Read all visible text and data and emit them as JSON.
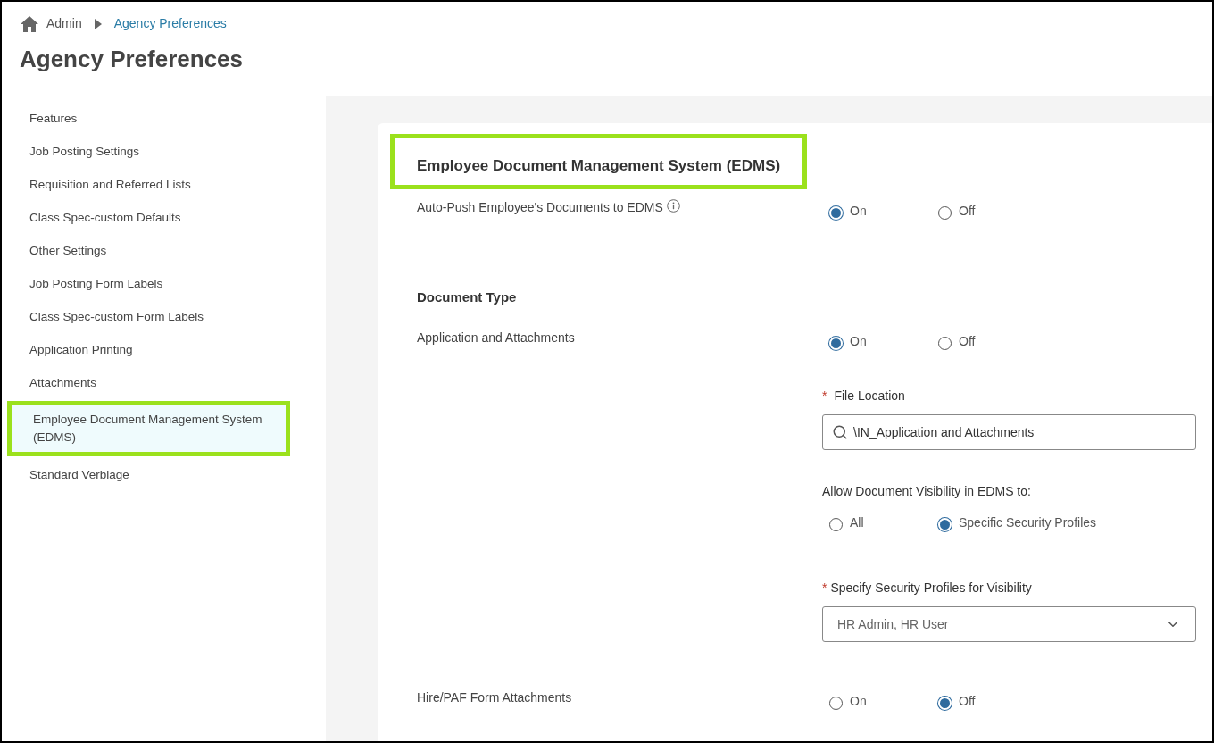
{
  "breadcrumb": [
    {
      "label": "Admin",
      "link": false
    },
    {
      "label": "Agency Preferences",
      "link": true
    }
  ],
  "title": "Agency Preferences",
  "sidebar": {
    "items": [
      {
        "label": "Features",
        "selected": false,
        "highlighted": false
      },
      {
        "label": "Job Posting Settings",
        "selected": false,
        "highlighted": false
      },
      {
        "label": "Requisition and Referred Lists",
        "selected": false,
        "highlighted": false
      },
      {
        "label": "Class Spec-custom Defaults",
        "selected": false,
        "highlighted": false
      },
      {
        "label": "Other Settings",
        "selected": false,
        "highlighted": false
      },
      {
        "label": "Job Posting Form Labels",
        "selected": false,
        "highlighted": false
      },
      {
        "label": "Class Spec-custom Form Labels",
        "selected": false,
        "highlighted": false
      },
      {
        "label": "Application Printing",
        "selected": false,
        "highlighted": false
      },
      {
        "label": "Attachments",
        "selected": false,
        "highlighted": false
      },
      {
        "label": "Employee Document Management System (EDMS)",
        "selected": true,
        "highlighted": true
      },
      {
        "label": "Standard Verbiage",
        "selected": false,
        "highlighted": false
      }
    ]
  },
  "section": {
    "title": "Employee Document Management System (EDMS)",
    "highlighted": true,
    "settings": [
      {
        "kind": "toggle",
        "label": "Auto-Push Employee's Documents to EDMS",
        "info": true,
        "options": [
          {
            "label": "On",
            "selected": true
          },
          {
            "label": "Off",
            "selected": false
          }
        ]
      },
      {
        "kind": "heading",
        "label": "Document Type"
      },
      {
        "kind": "toggle",
        "label": "Application and Attachments",
        "info": false,
        "options": [
          {
            "label": "On",
            "selected": true
          },
          {
            "label": "Off",
            "selected": false
          }
        ],
        "details": [
          {
            "kind": "search-field",
            "label": "File Location",
            "required_mark": "*",
            "value": "\\IN_Application and Attachments"
          },
          {
            "kind": "radio-group",
            "label": "Allow Document Visibility in EDMS to:",
            "options": [
              {
                "label": "All",
                "selected": false
              },
              {
                "label": "Specific Security Profiles",
                "selected": true
              }
            ]
          },
          {
            "kind": "select",
            "label": "Specify Security Profiles for Visibility",
            "required_mark": "*",
            "value": "HR Admin, HR User"
          }
        ]
      },
      {
        "kind": "toggle",
        "label": "Hire/PAF Form Attachments",
        "info": false,
        "options": [
          {
            "label": "On",
            "selected": false
          },
          {
            "label": "Off",
            "selected": true
          }
        ]
      }
    ]
  }
}
